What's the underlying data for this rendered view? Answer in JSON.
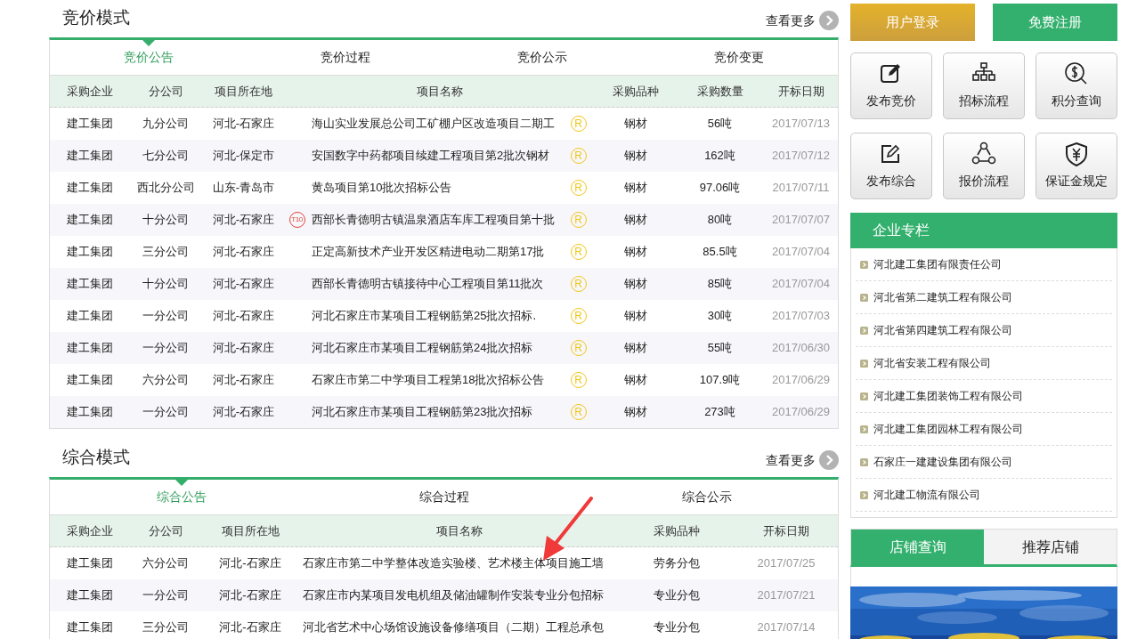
{
  "bidding": {
    "title": "竞价模式",
    "more": "查看更多",
    "tabs": [
      {
        "label": "竞价公告",
        "selected": true
      },
      {
        "label": "竞价过程",
        "selected": false
      },
      {
        "label": "竞价公示",
        "selected": false
      },
      {
        "label": "竞价变更",
        "selected": false
      }
    ],
    "columns": [
      "采购企业",
      "分公司",
      "项目所在地",
      "项目名称",
      "采购品种",
      "采购数量",
      "开标日期"
    ],
    "rows": [
      {
        "company": "建工集团",
        "branch": "九分公司",
        "location": "河北-石家庄",
        "name": "海山实业发展总公司工矿棚户区改造项目二期工",
        "mark": "R",
        "category": "钢材",
        "quantity": "56吨",
        "date": "2017/07/13"
      },
      {
        "company": "建工集团",
        "branch": "七分公司",
        "location": "河北-保定市",
        "name": "安国数字中药都项目续建工程项目第2批次钢材",
        "mark": "R",
        "category": "钢材",
        "quantity": "162吨",
        "date": "2017/07/12"
      },
      {
        "company": "建工集团",
        "branch": "西北分公司",
        "location": "山东-青岛市",
        "name": "黄岛项目第10批次招标公告",
        "mark": "R",
        "category": "钢材",
        "quantity": "97.06吨",
        "date": "2017/07/11"
      },
      {
        "company": "建工集团",
        "branch": "十分公司",
        "location": "河北-石家庄",
        "badge": "T10",
        "name": "西部长青德明古镇温泉酒店车库工程项目第十批",
        "mark": "R",
        "category": "钢材",
        "quantity": "80吨",
        "date": "2017/07/07"
      },
      {
        "company": "建工集团",
        "branch": "三分公司",
        "location": "河北-石家庄",
        "name": "正定高新技术产业开发区精进电动二期第17批",
        "mark": "R",
        "category": "钢材",
        "quantity": "85.5吨",
        "date": "2017/07/04"
      },
      {
        "company": "建工集团",
        "branch": "十分公司",
        "location": "河北-石家庄",
        "name": "西部长青德明古镇接待中心工程项目第11批次",
        "mark": "R",
        "category": "钢材",
        "quantity": "85吨",
        "date": "2017/07/04"
      },
      {
        "company": "建工集团",
        "branch": "一分公司",
        "location": "河北-石家庄",
        "name": "河北石家庄市某项目工程钢筋第25批次招标.",
        "mark": "R",
        "category": "钢材",
        "quantity": "30吨",
        "date": "2017/07/03"
      },
      {
        "company": "建工集团",
        "branch": "一分公司",
        "location": "河北-石家庄",
        "name": "河北石家庄市某项目工程钢筋第24批次招标",
        "mark": "R",
        "category": "钢材",
        "quantity": "55吨",
        "date": "2017/06/30"
      },
      {
        "company": "建工集团",
        "branch": "六分公司",
        "location": "河北-石家庄",
        "name": "石家庄市第二中学项目工程第18批次招标公告",
        "mark": "R",
        "category": "钢材",
        "quantity": "107.9吨",
        "date": "2017/06/29"
      },
      {
        "company": "建工集团",
        "branch": "一分公司",
        "location": "河北-石家庄",
        "name": "河北石家庄市某项目工程钢筋第23批次招标",
        "mark": "R",
        "category": "钢材",
        "quantity": "273吨",
        "date": "2017/06/29"
      }
    ]
  },
  "comprehensive": {
    "title": "综合模式",
    "more": "查看更多",
    "tabs": [
      {
        "label": "综合公告",
        "selected": true
      },
      {
        "label": "综合过程",
        "selected": false
      },
      {
        "label": "综合公示",
        "selected": false
      }
    ],
    "columns": [
      "采购企业",
      "分公司",
      "项目所在地",
      "项目名称",
      "采购品种",
      "开标日期"
    ],
    "rows": [
      {
        "company": "建工集团",
        "branch": "六分公司",
        "location": "河北-石家庄",
        "name": "石家庄市第二中学整体改造实验楼、艺术楼主体项目施工墙",
        "category": "劳务分包",
        "date": "2017/07/25"
      },
      {
        "company": "建工集团",
        "branch": "一分公司",
        "location": "河北-石家庄",
        "name": "石家庄市内某项目发电机组及储油罐制作安装专业分包招标",
        "category": "专业分包",
        "date": "2017/07/21"
      },
      {
        "company": "建工集团",
        "branch": "三分公司",
        "location": "河北-石家庄",
        "name": "河北省艺术中心场馆设施设备修缮项目（二期）工程总承包",
        "category": "专业分包",
        "date": "2017/07/14"
      }
    ]
  },
  "auth_buttons": [
    {
      "label": "用户登录",
      "kind": "login"
    },
    {
      "label": "免费注册",
      "kind": "register"
    }
  ],
  "quick_links": [
    "发布竞价",
    "招标流程",
    "积分查询",
    "发布综合",
    "报价流程",
    "保证金规定"
  ],
  "enterprise_column": {
    "title": "企业专栏",
    "items": [
      "河北建工集团有限责任公司",
      "河北省第二建筑工程有限公司",
      "河北省第四建筑工程有限公司",
      "河北省安装工程有限公司",
      "河北建工集团装饰工程有限公司",
      "河北建工集团园林工程有限公司",
      "石家庄一建建设集团有限公司",
      "河北建工物流有限公司"
    ]
  },
  "store_tabs": [
    {
      "label": "店铺查询",
      "selected": true
    },
    {
      "label": "推荐店铺",
      "selected": false
    }
  ],
  "banner": {
    "kind": "picture"
  }
}
